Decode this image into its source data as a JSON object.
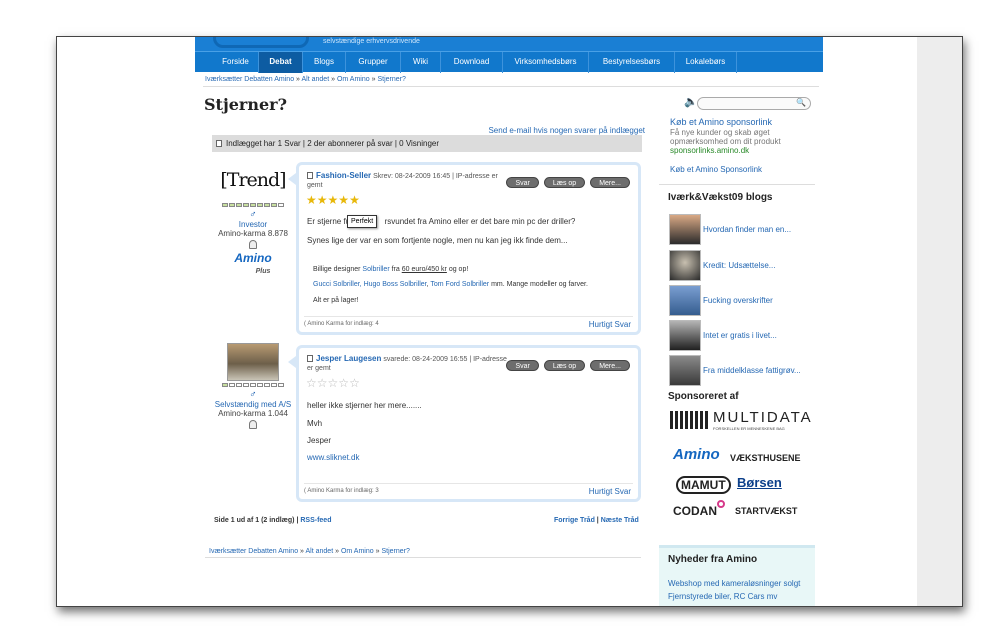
{
  "header": {
    "tagline": "selvstændige erhvervsdrivende"
  },
  "nav": {
    "items": [
      {
        "label": "Forside"
      },
      {
        "label": "Debat"
      },
      {
        "label": "Blogs"
      },
      {
        "label": "Grupper"
      },
      {
        "label": "Wiki"
      },
      {
        "label": "Download"
      },
      {
        "label": "Virksomhedsbørs"
      },
      {
        "label": "Bestyrelsesbørs"
      },
      {
        "label": "Lokalebørs"
      }
    ],
    "active": "Debat"
  },
  "breadcrumb": {
    "items": [
      "Iværksætter Debatten Amino",
      "Alt andet",
      "Om Amino",
      "Stjerner?"
    ],
    "sep": "»"
  },
  "page": {
    "title": "Stjerner?",
    "email_link": "Send e-mail hvis nogen svarer på indlægget",
    "status": "Indlægget har 1 Svar | 2 der abonnerer på svar | 0 Visninger"
  },
  "posts": [
    {
      "author": "Fashion-Seller",
      "meta": "Skrev: 08-24-2009 16:45 | IP-adresse er gemt",
      "author_logo": "[Trend]",
      "role": "Investor",
      "karma": "Amino-karma 8.878",
      "badge": "Amino",
      "badge_sub": "Plus",
      "rating": 5,
      "line1": "Er stjerne fun",
      "line1b": "rsvundet fra Amino eller er det bare min pc der driller?",
      "tooltip": "Perfekt",
      "line2": "Synes lige der var en som fortjente nogle, men nu kan jeg ikk finde dem...",
      "sig1a": "Billige designer ",
      "sig1link": "Solbriller",
      "sig1b": " fra ",
      "sig1price": "60 euro/450 kr",
      "sig1c": " og op!",
      "sig2link1": "Gucci Solbriller, Hugo Boss Solbriller",
      "sig2mid": ", ",
      "sig2link2": "Tom Ford Solbriller",
      "sig2end": " mm. Mange modeller og farver.",
      "sig3": "Alt er på lager!",
      "foot": "( Amino Karma for indlæg: 4",
      "quick": "Hurtigt Svar",
      "buttons": [
        "Svar",
        "Læs op",
        "Mere..."
      ]
    },
    {
      "author": "Jesper Laugesen",
      "meta": "svarede: 08-24-2009 16:55 | IP-adresse er gemt",
      "role": "Selvstændig med A/S",
      "karma": "Amino-karma 1.044",
      "rating": 0,
      "line1": "heller ikke stjerner her mere.......",
      "line2": "Mvh",
      "line3": "Jesper",
      "link": "www.sliknet.dk",
      "foot": "( Amino Karma for indlæg: 3",
      "quick": "Hurtigt Svar",
      "buttons": [
        "Svar",
        "Læs op",
        "Mere..."
      ]
    }
  ],
  "pager": {
    "text": "Side 1 ud af 1 (2 indlæg) | ",
    "rss": "RSS-feed",
    "prev": "Forrige Tråd",
    "sep": " | ",
    "next": "Næste Tråd"
  },
  "sidebar": {
    "sponsor_title": "Køb et Amino sponsorlink",
    "sponsor_text": "Få nye kunder og skab øget opmærksomhed om dit produkt",
    "sponsor_url": "sponsorlinks.amino.dk",
    "sponsor_link2": "Køb et Amino Sponsorlink",
    "blogs_head": "Iværk&Vækst09 blogs",
    "blogs": [
      "Hvordan finder man en...",
      "Kredit: Udsættelse...",
      "Fucking overskrifter",
      "Intet er gratis i livet...",
      "Fra middelklasse fattigrøv..."
    ],
    "sponsored_head": "Sponsoreret af",
    "sponsors": {
      "multidata": "MULTIDATA",
      "multidata_sub": "FORSKELLEN ER MENNESKENE BAG",
      "amino": "Amino",
      "vaekst": "VÆKSTHUSENE",
      "mamut": "MAMUT",
      "borsen": "Børsen",
      "codan": "CODAN",
      "start": "STARTVÆKST"
    },
    "news_head": "Nyheder fra Amino",
    "news": [
      "Webshop med kameraløsninger solgt",
      "Fjernstyrede biler, RC Cars mv"
    ]
  },
  "colors": {
    "nav": "#1178cc",
    "link": "#2568b3",
    "star": "#e8b80a"
  }
}
